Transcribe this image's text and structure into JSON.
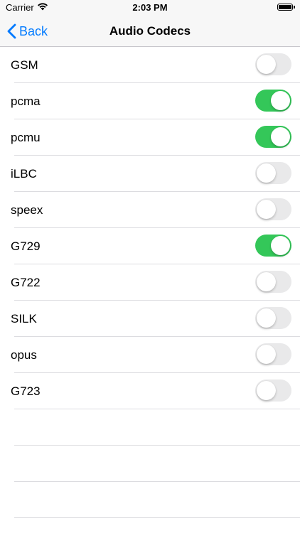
{
  "status_bar": {
    "carrier": "Carrier",
    "time": "2:03 PM"
  },
  "nav": {
    "back_label": "Back",
    "title": "Audio Codecs"
  },
  "codecs": [
    {
      "name": "GSM",
      "enabled": false
    },
    {
      "name": "pcma",
      "enabled": true
    },
    {
      "name": "pcmu",
      "enabled": true
    },
    {
      "name": "iLBC",
      "enabled": false
    },
    {
      "name": "speex",
      "enabled": false
    },
    {
      "name": "G729",
      "enabled": true
    },
    {
      "name": "G722",
      "enabled": false
    },
    {
      "name": "SILK",
      "enabled": false
    },
    {
      "name": "opus",
      "enabled": false
    },
    {
      "name": "G723",
      "enabled": false
    }
  ],
  "colors": {
    "accent": "#007aff",
    "toggle_on": "#34c759",
    "toggle_off": "#e9e9ea"
  }
}
